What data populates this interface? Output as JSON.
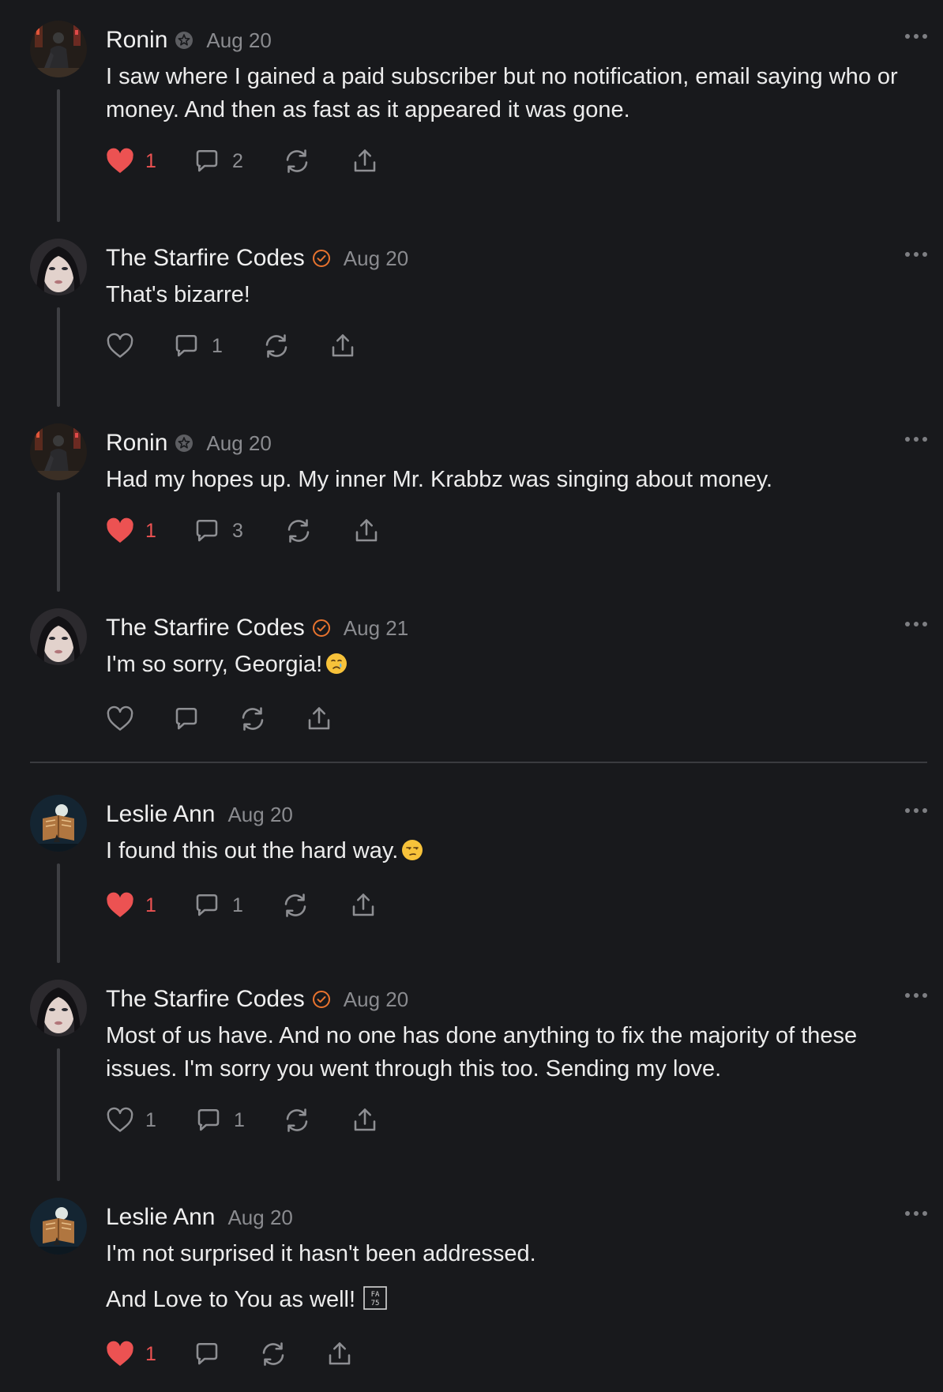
{
  "colors": {
    "background": "#18191c",
    "like_red": "#ec5252",
    "verified_orange": "#e8732e",
    "muted": "#8a8b8f"
  },
  "comments": [
    {
      "author": "Ronin",
      "badge": "subscriber-badge-icon",
      "date": "Aug 20",
      "paragraphs": [
        "I saw where I gained a paid subscriber but no notification, email saying who or money. And then as fast as it appeared it was gone."
      ],
      "liked": true,
      "likes": "1",
      "replies": "2"
    },
    {
      "author": "The Starfire Codes",
      "badge": "verified-check-icon",
      "date": "Aug 20",
      "paragraphs": [
        "That's bizarre!"
      ],
      "liked": false,
      "likes": "",
      "replies": "1"
    },
    {
      "author": "Ronin",
      "badge": "subscriber-badge-icon",
      "date": "Aug 20",
      "paragraphs": [
        "Had my hopes up. My inner Mr. Krabbz was singing about money."
      ],
      "liked": true,
      "likes": "1",
      "replies": "3"
    },
    {
      "author": "The Starfire Codes",
      "badge": "verified-check-icon",
      "date": "Aug 21",
      "paragraphs": [
        "I'm so sorry, Georgia!"
      ],
      "emoji": "crying-face-emoji",
      "liked": false,
      "likes": "",
      "replies": ""
    },
    {
      "author": "Leslie Ann",
      "badge": "",
      "date": "Aug 20",
      "paragraphs": [
        "I found this out the hard way."
      ],
      "emoji": "unamused-face-emoji",
      "liked": true,
      "likes": "1",
      "replies": "1"
    },
    {
      "author": "The Starfire Codes",
      "badge": "verified-check-icon",
      "date": "Aug 20",
      "paragraphs": [
        "Most of us have. And no one has done anything to fix the majority of these issues. I'm sorry you went through this too. Sending my love."
      ],
      "liked": false,
      "likes": "1",
      "replies": "1"
    },
    {
      "author": "Leslie Ann",
      "badge": "",
      "date": "Aug 20",
      "paragraphs": [
        "I'm not surprised it hasn't been addressed.",
        "And Love to You as well!"
      ],
      "missing_glyph": "01FA75",
      "liked": true,
      "likes": "1",
      "replies": ""
    }
  ]
}
